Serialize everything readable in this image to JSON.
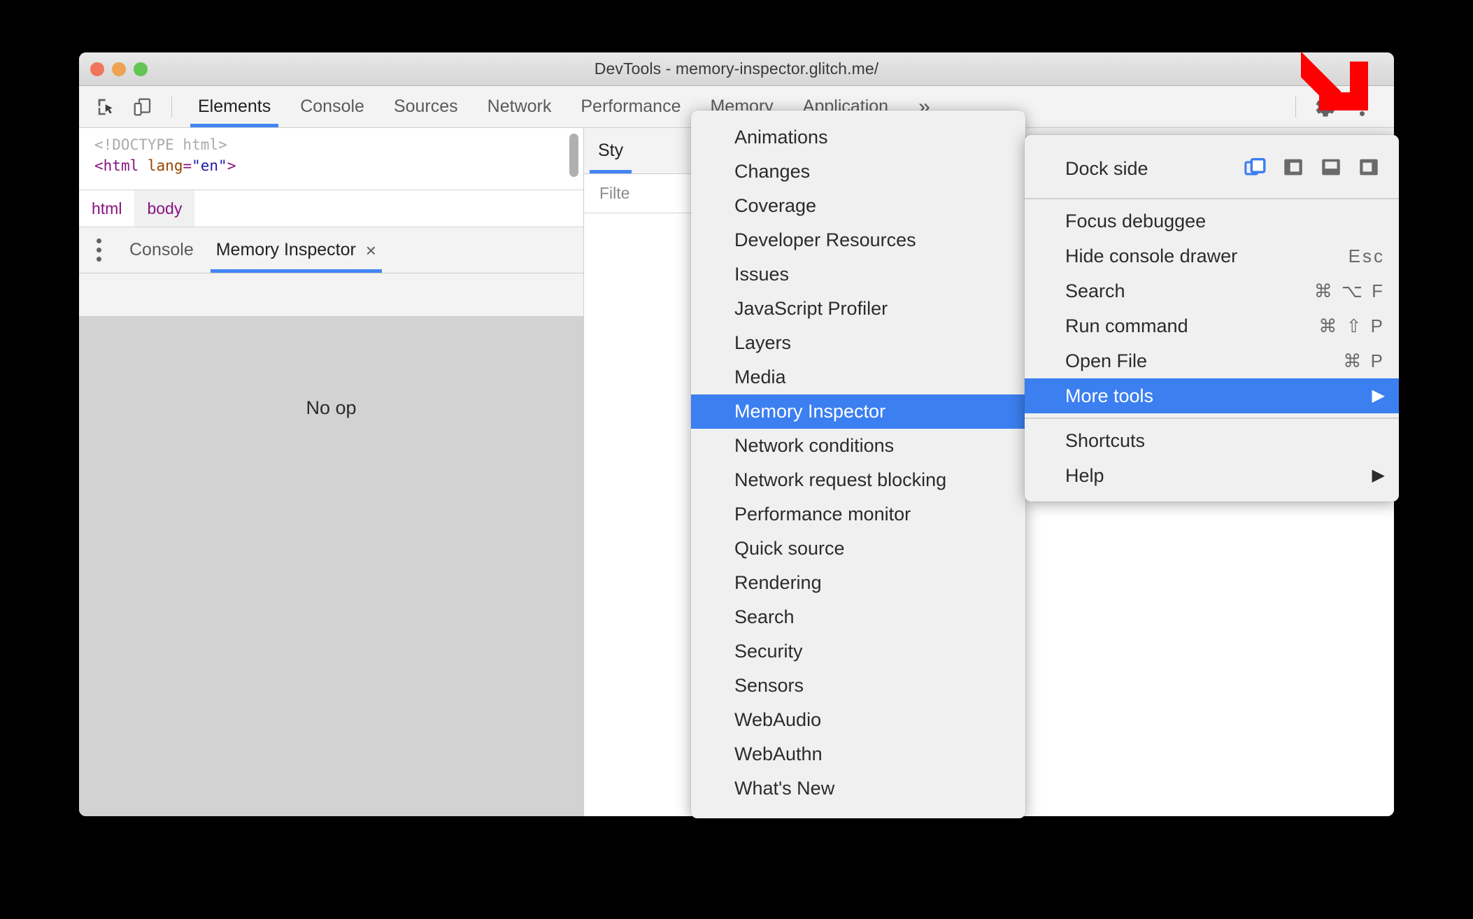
{
  "window": {
    "title": "DevTools - memory-inspector.glitch.me/",
    "traffic": {
      "close": "close-button",
      "minimize": "minimize-button",
      "zoom": "zoom-button"
    }
  },
  "toolbar": {
    "inspect_icon": "inspect-element-icon",
    "device_icon": "device-toolbar-icon",
    "tabs": [
      {
        "label": "Elements",
        "active": true
      },
      {
        "label": "Console",
        "active": false
      },
      {
        "label": "Sources",
        "active": false
      },
      {
        "label": "Network",
        "active": false
      },
      {
        "label": "Performance",
        "active": false
      },
      {
        "label": "Memory",
        "active": false
      },
      {
        "label": "Application",
        "active": false
      }
    ],
    "overflow": "»",
    "settings_icon": "gear-icon",
    "more_icon": "kebab-menu-icon"
  },
  "dom": {
    "line1": "<!DOCTYPE html>",
    "line2_open": "<",
    "line2_tag": "html",
    "line2_attr": "lang",
    "line2_eq": "=",
    "line2_val": "\"en\"",
    "line2_close": ">"
  },
  "breadcrumb": {
    "items": [
      "html",
      "body"
    ],
    "selected": "body"
  },
  "drawer": {
    "tabs": [
      {
        "label": "Console",
        "active": false,
        "closable": false
      },
      {
        "label": "Memory Inspector",
        "active": true,
        "closable": true
      }
    ],
    "close_glyph": "×",
    "empty_message": "No op"
  },
  "styles_pane": {
    "tab": "Sty",
    "filter_placeholder": "Filte"
  },
  "more_tools_menu": {
    "items": [
      {
        "label": "Animations",
        "highlighted": false
      },
      {
        "label": "Changes",
        "highlighted": false
      },
      {
        "label": "Coverage",
        "highlighted": false
      },
      {
        "label": "Developer Resources",
        "highlighted": false
      },
      {
        "label": "Issues",
        "highlighted": false
      },
      {
        "label": "JavaScript Profiler",
        "highlighted": false
      },
      {
        "label": "Layers",
        "highlighted": false
      },
      {
        "label": "Media",
        "highlighted": false
      },
      {
        "label": "Memory Inspector",
        "highlighted": true
      },
      {
        "label": "Network conditions",
        "highlighted": false
      },
      {
        "label": "Network request blocking",
        "highlighted": false
      },
      {
        "label": "Performance monitor",
        "highlighted": false
      },
      {
        "label": "Quick source",
        "highlighted": false
      },
      {
        "label": "Rendering",
        "highlighted": false
      },
      {
        "label": "Search",
        "highlighted": false
      },
      {
        "label": "Security",
        "highlighted": false
      },
      {
        "label": "Sensors",
        "highlighted": false
      },
      {
        "label": "WebAudio",
        "highlighted": false
      },
      {
        "label": "WebAuthn",
        "highlighted": false
      },
      {
        "label": "What's New",
        "highlighted": false
      }
    ]
  },
  "settings_menu": {
    "dock_side_label": "Dock side",
    "dock_options": [
      {
        "name": "undock-into-separate-window-icon",
        "selected": true
      },
      {
        "name": "dock-to-left-icon",
        "selected": false
      },
      {
        "name": "dock-to-bottom-icon",
        "selected": false
      },
      {
        "name": "dock-to-right-icon",
        "selected": false
      }
    ],
    "items": [
      {
        "label": "Focus debuggee",
        "shortcut": "",
        "highlighted": false,
        "submenu": false
      },
      {
        "label": "Hide console drawer",
        "shortcut": "Esc",
        "highlighted": false,
        "submenu": false
      },
      {
        "label": "Search",
        "shortcut": "⌘ ⌥ F",
        "highlighted": false,
        "submenu": false
      },
      {
        "label": "Run command",
        "shortcut": "⌘ ⇧ P",
        "highlighted": false,
        "submenu": false
      },
      {
        "label": "Open File",
        "shortcut": "⌘ P",
        "highlighted": false,
        "submenu": false
      },
      {
        "label": "More tools",
        "shortcut": "",
        "highlighted": true,
        "submenu": true
      }
    ],
    "items_bottom": [
      {
        "label": "Shortcuts",
        "shortcut": "",
        "highlighted": false,
        "submenu": false
      },
      {
        "label": "Help",
        "shortcut": "",
        "highlighted": false,
        "submenu": true
      }
    ],
    "submenu_arrow": "▶"
  },
  "annotation": {
    "arrow_color": "#ff0000",
    "arrow_name": "red-pointer-arrow",
    "points_at": "kebab-menu-icon"
  },
  "colors": {
    "accent_blue": "#4285f4",
    "highlight_blue": "#3b7ff0",
    "menu_bg": "#f0f0f0",
    "drawer_bg": "#d2d2d2",
    "toolbar_bg": "#f3f3f3"
  }
}
